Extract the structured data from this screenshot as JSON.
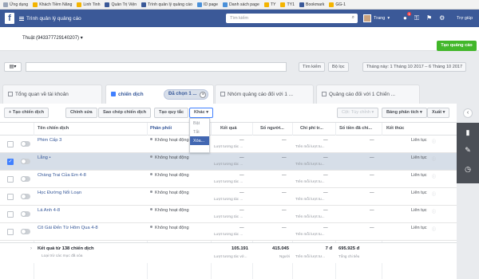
{
  "bookmarks": [
    "Ứng dụng",
    "Khách Tiềm Năng",
    "Linh Tinh",
    "Quản Trị Viện",
    "Trình quản lý quảng cáo",
    "ID page",
    "Danh sách page",
    "TY",
    "TY1",
    "Bookmark",
    "GG-1"
  ],
  "header": {
    "app_title": "Trình quản lý quảng cáo",
    "search_placeholder": "Tìm kiếm",
    "user_name": "Trang",
    "badge_count": "1",
    "help_label": "Trợ giúp"
  },
  "account": {
    "selector": "Thuật (943377729140207) ▾",
    "create_ad": "Tạo quảng cáo"
  },
  "filters": {
    "search": "Tìm kiếm",
    "filter": "Bộ lọc",
    "date_range": "Tháng này: 1 Tháng 10 2017 – 6 Tháng 10 2017"
  },
  "tabs": {
    "overview": "Tổng quan về tài khoản",
    "campaigns": "chiến dịch",
    "selected": "Đã chọn 1 ...",
    "adsets": "Nhóm quảng cáo đối với 1 ...",
    "ads": "Quảng cáo đối với 1 Chiến ..."
  },
  "toolbar": {
    "create": "+ Tạo chiến dịch",
    "edit": "Chỉnh sửa",
    "duplicate": "Sao chép chiến dịch",
    "rules": "Tạo quy tắc",
    "more": "Khác ▾",
    "columns": "Cột: Tùy chỉnh ▾",
    "breakdown": "Bảng phân tích ▾",
    "export": "Xuất ▾"
  },
  "dropdown": [
    "Bật",
    "Tắt",
    "Xóa..."
  ],
  "columns": {
    "name": "Tên chiến dịch",
    "delivery": "Phân phối",
    "results": "Kết quả",
    "reach": "Số người...",
    "cost": "Chi phí tr...",
    "spent": "Số tiền đã chi...",
    "end": "Kết thúc"
  },
  "rows": [
    {
      "name": "Phim Cấp 3",
      "status": "Không hoạt động",
      "result_sub": "Lượt tương tác ...",
      "cost_sub": "Trên mỗi lượt tu...",
      "end": "Liên tục",
      "selected": false
    },
    {
      "name": "Lằng •",
      "status": "Không hoạt động",
      "result_sub": "Lượt tương tác ...",
      "cost_sub": "Trên mỗi lượt tu...",
      "end": "Liên tục",
      "selected": true
    },
    {
      "name": "Chàng Trai Của Em 4-8",
      "status": "Không hoạt động",
      "result_sub": "Lượt tương tác ...",
      "cost_sub": "Trên mỗi lượt tu...",
      "end": "Liên tục",
      "selected": false
    },
    {
      "name": "Học Đường Nổi Loạn",
      "status": "Không hoạt động",
      "result_sub": "Lượt tương tác ...",
      "cost_sub": "Trên mỗi lượt tu...",
      "end": "Liên tục",
      "selected": false
    },
    {
      "name": "Lá Anh 4-8",
      "status": "Không hoạt động",
      "result_sub": "Lượt tương tác ...",
      "cost_sub": "Trên mỗi lượt tu...",
      "end": "Liên tục",
      "selected": false
    },
    {
      "name": "Cô Gái Đến Từ Hôm Qua 4-8",
      "status": "Không hoạt động",
      "result_sub": "Lượt tương tác ...",
      "cost_sub": "Trên mỗi lượt tu...",
      "end": "Liên tục",
      "selected": false
    }
  ],
  "dash": "—",
  "totals": {
    "label": "Kết quả từ 138 chiến dịch",
    "sub": "Loại trừ các mục đã xóa",
    "results": "105.191",
    "results_sub": "Lượt tương tác vớ...",
    "reach": "415.045",
    "reach_sub": "Người",
    "cost": "7 đ",
    "cost_sub": "Trên mỗi lượt tư...",
    "spent": "695.925 đ",
    "spent_sub": "Tổng chi tiêu"
  },
  "icons": {
    "rail": [
      "back-circle-icon",
      "bar-chart-icon",
      "pencil-icon",
      "clock-icon"
    ]
  },
  "colors": {
    "fb_blue": "#3b5998",
    "create_green": "#42b72a",
    "selected_row": "#d6dee8",
    "dropdown_active": "#4267b2"
  }
}
